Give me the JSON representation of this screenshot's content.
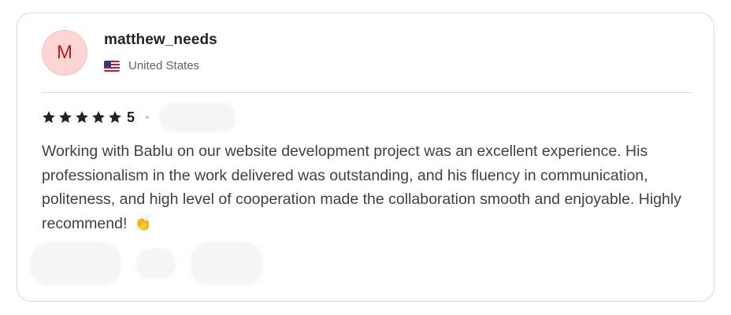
{
  "review": {
    "avatar_initial": "M",
    "username": "matthew_needs",
    "country": "United States",
    "flag_icon": "us-flag-icon",
    "rating": {
      "stars": 5,
      "value": "5",
      "star_icon": "star-icon",
      "star_color": "#222325"
    },
    "text": "Working with Bablu on our website development project was an excellent experience. His professionalism in the work delivered was outstanding, and his fluency in communication, politeness, and high level of cooperation made the collaboration smooth and enjoyable. Highly recommend!",
    "emoji": "👏"
  },
  "colors": {
    "avatar_bg": "#fdd5d5",
    "avatar_text": "#b21e23",
    "text_primary": "#222325",
    "text_secondary": "#62646a",
    "border": "#dadbdd"
  }
}
